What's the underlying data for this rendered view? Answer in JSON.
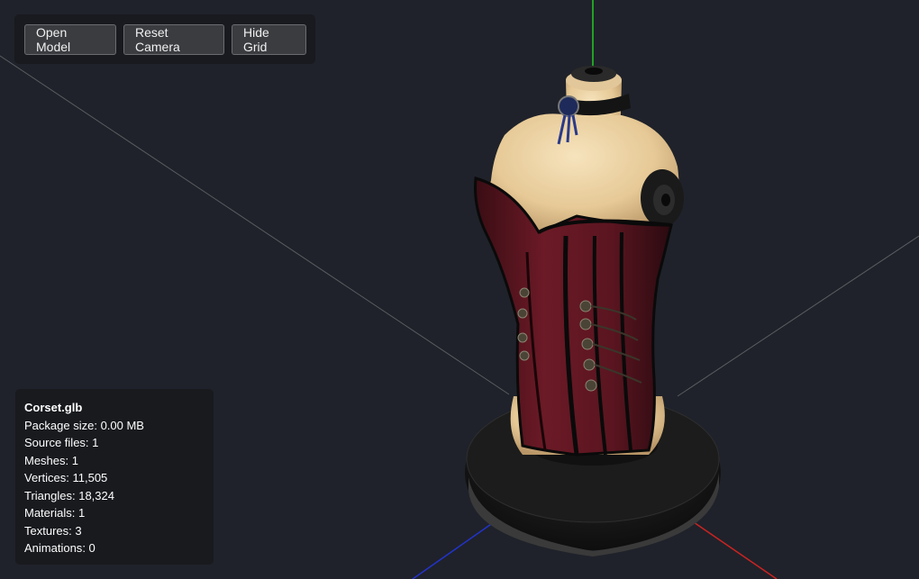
{
  "toolbar": {
    "open_model": "Open Model",
    "reset_camera": "Reset Camera",
    "hide_grid": "Hide Grid"
  },
  "info": {
    "file_name": "Corset.glb",
    "stats": [
      {
        "label": "Package size",
        "value": "0.00 MB"
      },
      {
        "label": "Source files",
        "value": "1"
      },
      {
        "label": "Meshes",
        "value": "1"
      },
      {
        "label": "Vertices",
        "value": "11,505"
      },
      {
        "label": "Triangles",
        "value": "18,324"
      },
      {
        "label": "Materials",
        "value": "1"
      },
      {
        "label": "Textures",
        "value": "3"
      },
      {
        "label": "Animations",
        "value": "0"
      }
    ]
  },
  "colors": {
    "background": "#1f222a",
    "axis_x": "#cc2222",
    "axis_y": "#22cc22",
    "axis_z": "#2233cc",
    "grid": "#5a5c60",
    "corset": "#5a1620",
    "mannequin": "#e8cfa0"
  }
}
